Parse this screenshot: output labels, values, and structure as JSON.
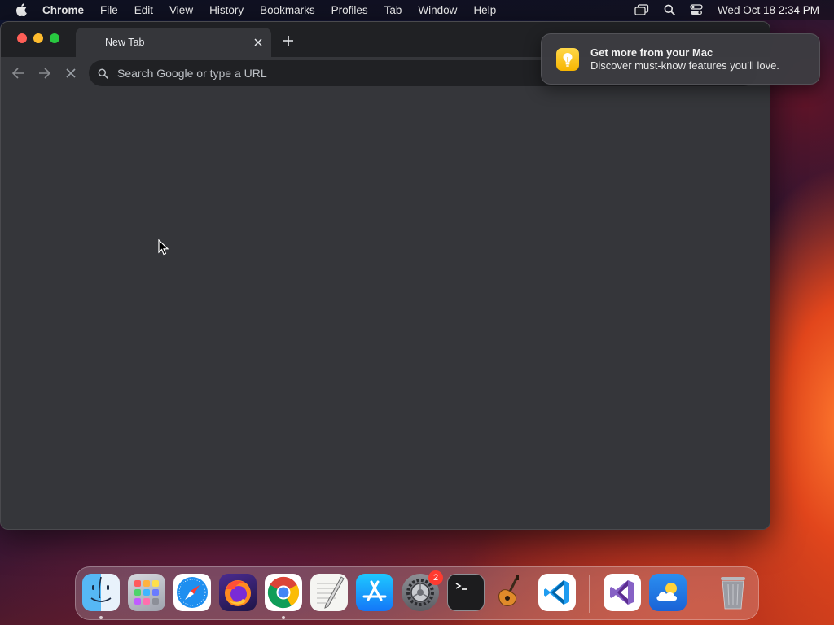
{
  "menubar": {
    "app_name": "Chrome",
    "items": [
      "File",
      "Edit",
      "View",
      "History",
      "Bookmarks",
      "Profiles",
      "Tab",
      "Window",
      "Help"
    ],
    "clock": "Wed Oct 18  2:34 PM"
  },
  "browser": {
    "tab_title": "New Tab",
    "omnibox_placeholder": "Search Google or type a URL"
  },
  "notification": {
    "title": "Get more from your Mac",
    "body": "Discover must-know features you’ll love."
  },
  "dock": {
    "items": [
      {
        "name": "Finder",
        "icon": "finder-icon",
        "running": true
      },
      {
        "name": "Launchpad",
        "icon": "launchpad-icon",
        "running": false
      },
      {
        "name": "Safari",
        "icon": "safari-icon",
        "running": false
      },
      {
        "name": "Firefox",
        "icon": "firefox-icon",
        "running": false
      },
      {
        "name": "Google Chrome",
        "icon": "chrome-icon",
        "running": true
      },
      {
        "name": "TextEdit",
        "icon": "textedit-icon",
        "running": false
      },
      {
        "name": "App Store",
        "icon": "app-store-icon",
        "running": false
      },
      {
        "name": "System Settings",
        "icon": "system-settings-icon",
        "running": false,
        "badge": "2"
      },
      {
        "name": "Terminal",
        "icon": "terminal-icon",
        "running": false
      },
      {
        "name": "GarageBand",
        "icon": "garageband-icon",
        "running": false
      },
      {
        "name": "Visual Studio Code",
        "icon": "vscode-icon",
        "running": false
      },
      {
        "name": "Visual Studio",
        "icon": "visual-studio-icon",
        "running": false
      },
      {
        "name": "Weather",
        "icon": "weather-icon",
        "running": false
      },
      {
        "name": "Trash",
        "icon": "trash-icon",
        "running": false
      }
    ]
  },
  "colors": {
    "window_bg": "#35363a",
    "titlebar_bg": "#202124",
    "badge": "#ff3b30"
  }
}
